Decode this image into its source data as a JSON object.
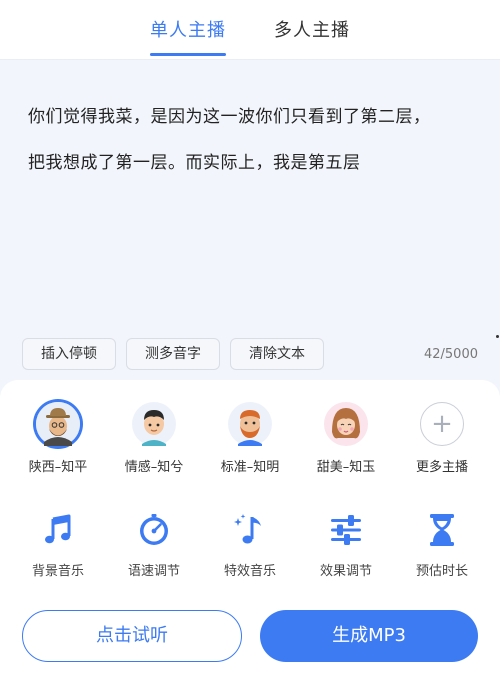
{
  "tabs": [
    {
      "label": "单人主播",
      "active": true
    },
    {
      "label": "多人主播",
      "active": false
    }
  ],
  "editor": {
    "lines": [
      "你们觉得我菜，是因为这一波你们只看到了第二层，",
      "把我想成了第一层。而实际上，我是第五层"
    ],
    "buttons": {
      "insert_pause": "插入停顿",
      "polyphone": "测多音字",
      "clear_text": "清除文本"
    },
    "char_count": "42/5000"
  },
  "voices": [
    {
      "label": "陕西–知平",
      "icon": "man-hat-avatar",
      "selected": true
    },
    {
      "label": "情感–知兮",
      "icon": "boy-avatar",
      "selected": false
    },
    {
      "label": "标准–知明",
      "icon": "bearded-man-avatar",
      "selected": false
    },
    {
      "label": "甜美–知玉",
      "icon": "woman-avatar",
      "selected": false
    },
    {
      "label": "更多主播",
      "icon": "plus-icon",
      "selected": false
    }
  ],
  "functions": [
    {
      "label": "背景音乐",
      "icon": "music-note-icon"
    },
    {
      "label": "语速调节",
      "icon": "speed-gauge-icon"
    },
    {
      "label": "特效音乐",
      "icon": "sparkle-music-icon"
    },
    {
      "label": "效果调节",
      "icon": "sliders-icon"
    },
    {
      "label": "预估时长",
      "icon": "hourglass-icon"
    }
  ],
  "actions": {
    "preview": "点击试听",
    "generate": "生成MP3"
  },
  "colors": {
    "accent": "#3d7bf3",
    "background": "#f2f5fb"
  }
}
